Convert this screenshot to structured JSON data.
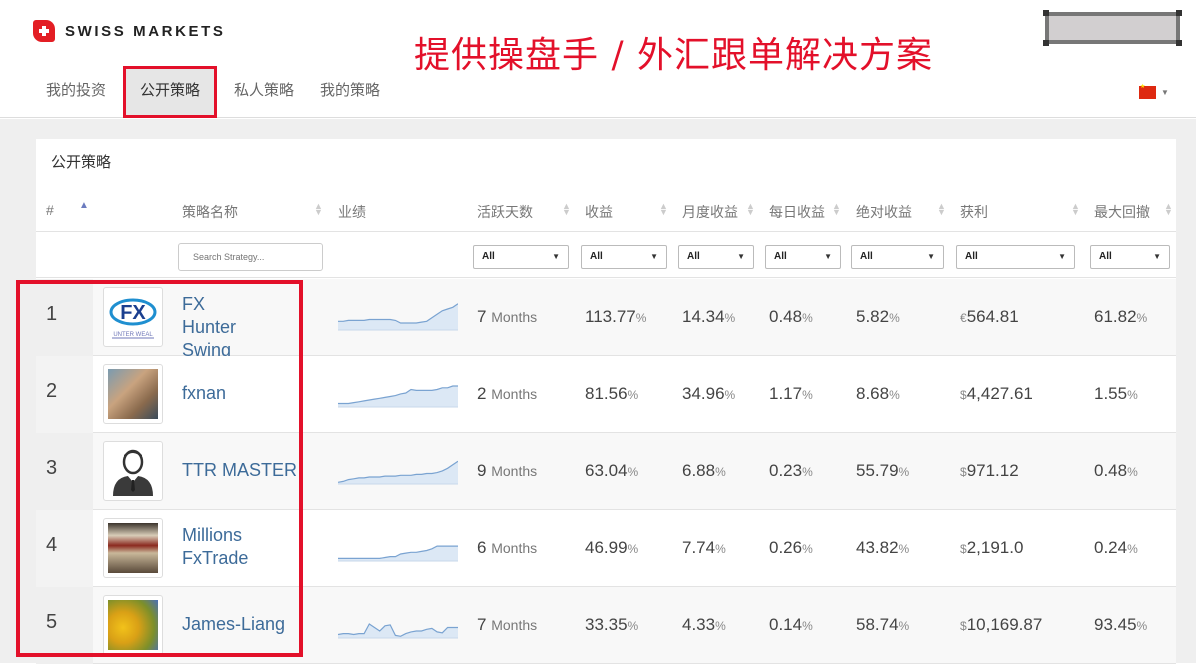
{
  "brand": {
    "name": "SWISS MARKETS",
    "accent": "#e31e24"
  },
  "promo_text": "提供操盘手 / 外汇跟单解决方案",
  "nav": {
    "items": [
      {
        "label": "我的投资",
        "active": false
      },
      {
        "label": "公开策略",
        "active": true
      },
      {
        "label": "私人策略",
        "active": false
      },
      {
        "label": "我的策略",
        "active": false
      }
    ]
  },
  "language": {
    "flag": "cn-flag-icon"
  },
  "panel": {
    "title": "公开策略",
    "columns": {
      "rank": "#",
      "name": "策略名称",
      "performance": "业绩",
      "active_days": "活跃天数",
      "gain": "收益",
      "monthly": "月度收益",
      "daily": "每日收益",
      "absolute": "绝对收益",
      "profit": "获利",
      "drawdown": "最大回撤"
    },
    "search_placeholder": "Search Strategy...",
    "filter_value": "All"
  },
  "strategies": [
    {
      "rank": "1",
      "name": "FX Hunter Swing",
      "avatar": "fx-hunter-logo",
      "months": "7",
      "months_label": "Months",
      "gain": "113.77",
      "monthly": "14.34",
      "daily": "0.48",
      "absolute": "5.82",
      "currency": "€",
      "profit": "564.81",
      "drawdown": "61.82",
      "spark": [
        10,
        10,
        11,
        11,
        11,
        11,
        12,
        12,
        12,
        12,
        12,
        11,
        8,
        8,
        8,
        8,
        9,
        10,
        14,
        18,
        22,
        24,
        26,
        30
      ]
    },
    {
      "rank": "2",
      "name": "fxnan",
      "avatar": "person-photo",
      "months": "2",
      "months_label": "Months",
      "gain": "81.56",
      "monthly": "34.96",
      "daily": "1.17",
      "absolute": "8.68",
      "currency": "$",
      "profit": "4,427.61",
      "drawdown": "1.55",
      "spark": [
        4,
        4,
        4,
        5,
        6,
        7,
        8,
        9,
        10,
        11,
        12,
        13,
        15,
        16,
        20,
        19,
        19,
        19,
        19,
        20,
        22,
        22,
        24,
        24
      ]
    },
    {
      "rank": "3",
      "name": "TTR MASTER",
      "avatar": "businessman-icon",
      "months": "9",
      "months_label": "Months",
      "gain": "63.04",
      "monthly": "6.88",
      "daily": "0.23",
      "absolute": "55.79",
      "currency": "$",
      "profit": "971.12",
      "drawdown": "0.48",
      "spark": [
        2,
        3,
        5,
        6,
        7,
        7,
        8,
        8,
        8,
        9,
        9,
        9,
        10,
        10,
        10,
        11,
        11,
        12,
        12,
        13,
        15,
        18,
        22,
        26
      ]
    },
    {
      "rank": "4",
      "name": "Millions FxTrade",
      "avatar": "be-thankful-poster",
      "months": "6",
      "months_label": "Months",
      "gain": "46.99",
      "monthly": "7.74",
      "daily": "0.26",
      "absolute": "43.82",
      "currency": "$",
      "profit": "2,191.0",
      "drawdown": "0.24",
      "spark": [
        3,
        3,
        3,
        3,
        3,
        3,
        3,
        3,
        3,
        4,
        5,
        5,
        8,
        9,
        10,
        10,
        11,
        12,
        14,
        17,
        17,
        17,
        17,
        17
      ]
    },
    {
      "rank": "5",
      "name": "James-Liang",
      "avatar": "yellow-tulips-photo",
      "months": "7",
      "months_label": "Months",
      "gain": "33.35",
      "monthly": "4.33",
      "daily": "0.14",
      "absolute": "58.74",
      "currency": "$",
      "profit": "10,169.87",
      "drawdown": "93.45",
      "spark": [
        4,
        5,
        5,
        4,
        5,
        5,
        16,
        12,
        8,
        14,
        15,
        3,
        2,
        5,
        7,
        8,
        8,
        10,
        11,
        7,
        6,
        12,
        12,
        12
      ]
    }
  ]
}
